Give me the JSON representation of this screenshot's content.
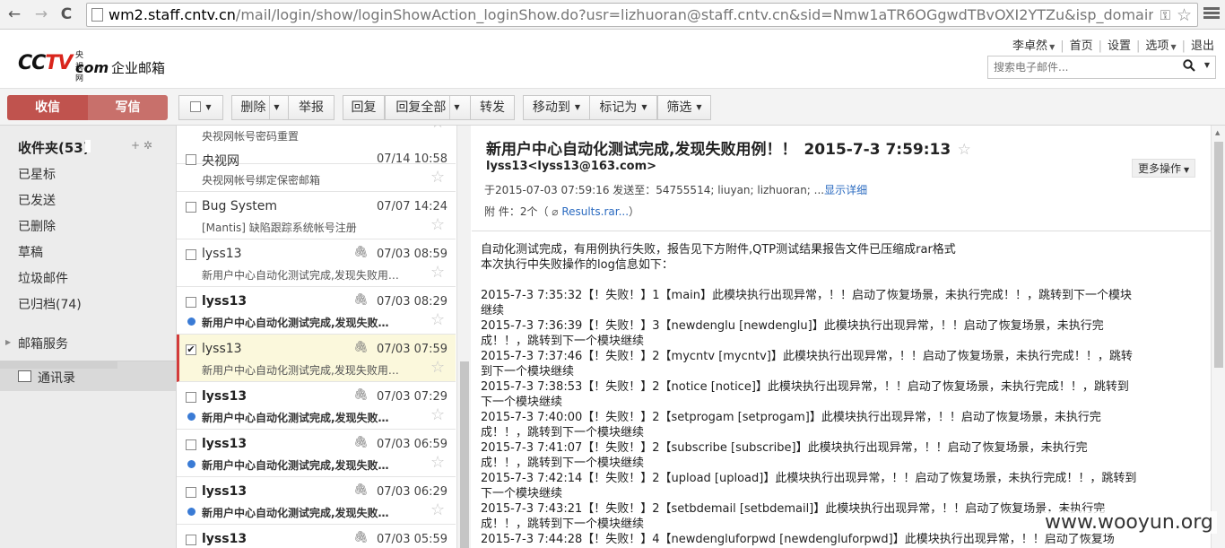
{
  "browser": {
    "url_host": "wm2.staff.cntv.cn",
    "url_rest": "/mail/login/show/loginShowAction_loginShow.do?usr=lizhuoran@staff.cntv.cn&sid=Nmw1aTR6OGgwdTBvOXI2YTZu&isp_domain=&u",
    "back_icon": "←",
    "forward_icon": "→",
    "reload_icon": "C"
  },
  "header": {
    "logo_cctv_a": "CC",
    "logo_cctv_b": "TV",
    "logo_yangshi": "央视网",
    "logo_com": "com",
    "logo_qiye": "企业邮箱",
    "user": "李卓然",
    "home": "首页",
    "settings": "设置",
    "options": "选项",
    "logout": "退出",
    "search_placeholder": "搜索电子邮件..."
  },
  "toolbar": {
    "inbox": "收信",
    "compose": "写信",
    "delete": "删除",
    "report": "举报",
    "reply": "回复",
    "reply_all": "回复全部",
    "forward": "转发",
    "move_to": "移动到",
    "mark_as": "标记为",
    "filter": "筛选"
  },
  "sidebar": {
    "inbox_label": "收件夹(53)",
    "tools": "+ ✲",
    "folders": [
      "已星标",
      "已发送",
      "已删除",
      "草稿",
      "垃圾邮件",
      "已归档(74)"
    ],
    "services": "邮箱服务",
    "contacts": "通讯录"
  },
  "mails": [
    {
      "sender": "",
      "date": "",
      "subject": "央视网帐号密码重置",
      "unread": false,
      "selected": false,
      "checked": false,
      "attach": false
    },
    {
      "sender": "央视网",
      "date": "07/14 10:58",
      "subject": "央视网帐号绑定保密邮箱",
      "unread": false,
      "selected": false,
      "checked": false,
      "attach": false
    },
    {
      "sender": "Bug System",
      "date": "07/07 14:24",
      "subject": "[Mantis] 缺陷跟踪系统帐号注册",
      "unread": false,
      "selected": false,
      "checked": false,
      "attach": false
    },
    {
      "sender": "lyss13",
      "date": "07/03 08:59",
      "subject": "新用户中心自动化测试完成,发现失败用…",
      "unread": false,
      "selected": false,
      "checked": false,
      "attach": true
    },
    {
      "sender": "lyss13",
      "date": "07/03 08:29",
      "subject": "新用户中心自动化测试完成,发现失败…",
      "unread": true,
      "selected": false,
      "checked": false,
      "attach": true
    },
    {
      "sender": "lyss13",
      "date": "07/03 07:59",
      "subject": "新用户中心自动化测试完成,发现失败用…",
      "unread": false,
      "selected": true,
      "checked": true,
      "attach": true
    },
    {
      "sender": "lyss13",
      "date": "07/03 07:29",
      "subject": "新用户中心自动化测试完成,发现失败…",
      "unread": true,
      "selected": false,
      "checked": false,
      "attach": true
    },
    {
      "sender": "lyss13",
      "date": "07/03 06:59",
      "subject": "新用户中心自动化测试完成,发现失败…",
      "unread": true,
      "selected": false,
      "checked": false,
      "attach": true
    },
    {
      "sender": "lyss13",
      "date": "07/03 06:29",
      "subject": "新用户中心自动化测试完成,发现失败…",
      "unread": true,
      "selected": false,
      "checked": false,
      "attach": true
    },
    {
      "sender": "lyss13",
      "date": "07/03 05:59",
      "subject": "",
      "unread": true,
      "selected": false,
      "checked": false,
      "attach": true
    }
  ],
  "message": {
    "subject": "新用户中心自动化测试完成,发现失败用例！！",
    "datetime": "2015-7-3 7:59:13",
    "from": "lyss13<lyss13@163.com>",
    "more": "更多操作",
    "meta_prefix": "于2015-07-03 07:59:16 发送至：54755514; liuyan; lizhuoran; ...",
    "meta_link": "显示详细",
    "attach_prefix": "附  件：2个（ ",
    "attach_link": "Results.rar...",
    "attach_suffix": "）",
    "body_intro": [
      "自动化测试完成，有用例执行失败，报告见下方附件,QTP测试结果报告文件已压缩成rar格式",
      "本次执行中失败操作的log信息如下："
    ],
    "body_log": [
      "2015-7-3 7:35:32【！失败！】1【main】此模块执行出现异常，！！启动了恢复场景，未执行完成！！，跳转到下一个模块",
      "继续",
      "2015-7-3 7:36:39【！失败！】3【newdenglu [newdenglu]】此模块执行出现异常，！！启动了恢复场景，未执行完",
      "成！！，跳转到下一个模块继续",
      "2015-7-3 7:37:46【！失败！】2【mycntv [mycntv]】此模块执行出现异常，！！启动了恢复场景，未执行完成！！，跳转",
      "到下一个模块继续",
      "2015-7-3 7:38:53【！失败！】2【notice [notice]】此模块执行出现异常，！！启动了恢复场景，未执行完成！！，跳转到",
      "下一个模块继续",
      "2015-7-3 7:40:00【！失败！】2【setprogam [setprogam]】此模块执行出现异常，！！启动了恢复场景，未执行完",
      "成！！，跳转到下一个模块继续",
      "2015-7-3 7:41:07【！失败！】2【subscribe [subscribe]】此模块执行出现异常，！！启动了恢复场景，未执行完",
      "成！！，跳转到下一个模块继续",
      "2015-7-3 7:42:14【！失败！】2【upload [upload]】此模块执行出现异常，！！启动了恢复场景，未执行完成！！，跳转到",
      "下一个模块继续",
      "2015-7-3 7:43:21【！失败！】2【setbdemail [setbdemail]】此模块执行出现异常，！！启动了恢复场景，未执行完",
      "成！！，跳转到下一个模块继续",
      "2015-7-3 7:44:28【！失败！】4【newdengluforpwd [newdengluforpwd]】此模块执行出现异常，！！启动了恢复场"
    ]
  },
  "watermark": "www.wooyun.org"
}
